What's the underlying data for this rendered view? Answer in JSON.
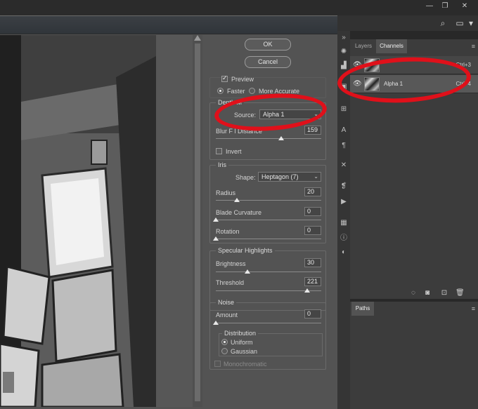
{
  "window_controls": {
    "minimize": "—",
    "restore": "❐",
    "close": "✕"
  },
  "optionsbar": {
    "search_icon": "⌕",
    "workspace_icon": "▭",
    "dropdown_icon": "▾"
  },
  "dialog": {
    "ok_label": "OK",
    "cancel_label": "Cancel",
    "preview": {
      "label": "Preview",
      "checked": true
    },
    "quality": {
      "options": [
        "Faster",
        "More Accurate"
      ],
      "selected": "Faster"
    },
    "depth_map": {
      "title": "Depth M",
      "source_label": "Source:",
      "source_value": "Alpha 1",
      "blur_focal_label": "Blur F      l Distance",
      "blur_focal_value": "159",
      "blur_focal_level": 0.62,
      "invert_label": "Invert",
      "invert_checked": false
    },
    "iris": {
      "title": "Iris",
      "shape_label": "Shape:",
      "shape_value": "Heptagon (7)",
      "radius_label": "Radius",
      "radius_value": "20",
      "radius_level": 0.2,
      "blade_label": "Blade Curvature",
      "blade_value": "0",
      "blade_level": 0,
      "rotation_label": "Rotation",
      "rotation_value": "0",
      "rotation_level": 0
    },
    "specular": {
      "title": "Specular Highlights",
      "brightness_label": "Brightness",
      "brightness_value": "30",
      "brightness_level": 0.3,
      "threshold_label": "Threshold",
      "threshold_value": "221",
      "threshold_level": 0.87
    },
    "noise": {
      "title": "Noise",
      "amount_label": "Amount",
      "amount_value": "0",
      "amount_level": 0,
      "distribution_title": "Distribution",
      "distribution_options": [
        "Uniform",
        "Gaussian"
      ],
      "distribution_selected": "Uniform",
      "monochromatic_label": "Monochromatic"
    }
  },
  "panels": {
    "tabs": [
      "Layers",
      "Channels"
    ],
    "active_tab": "Channels",
    "channels": [
      {
        "name": "",
        "shortcut": "Ctrl+3"
      },
      {
        "name": "Alpha 1",
        "shortcut": "Ctrl+4"
      }
    ],
    "paths_tab": "Paths",
    "footer_icons": [
      "dotted-circle",
      "mask",
      "new-channel",
      "trash"
    ],
    "menu_icon": "≡",
    "collapse_icon": "»"
  },
  "annotation_color": "#e0101a"
}
